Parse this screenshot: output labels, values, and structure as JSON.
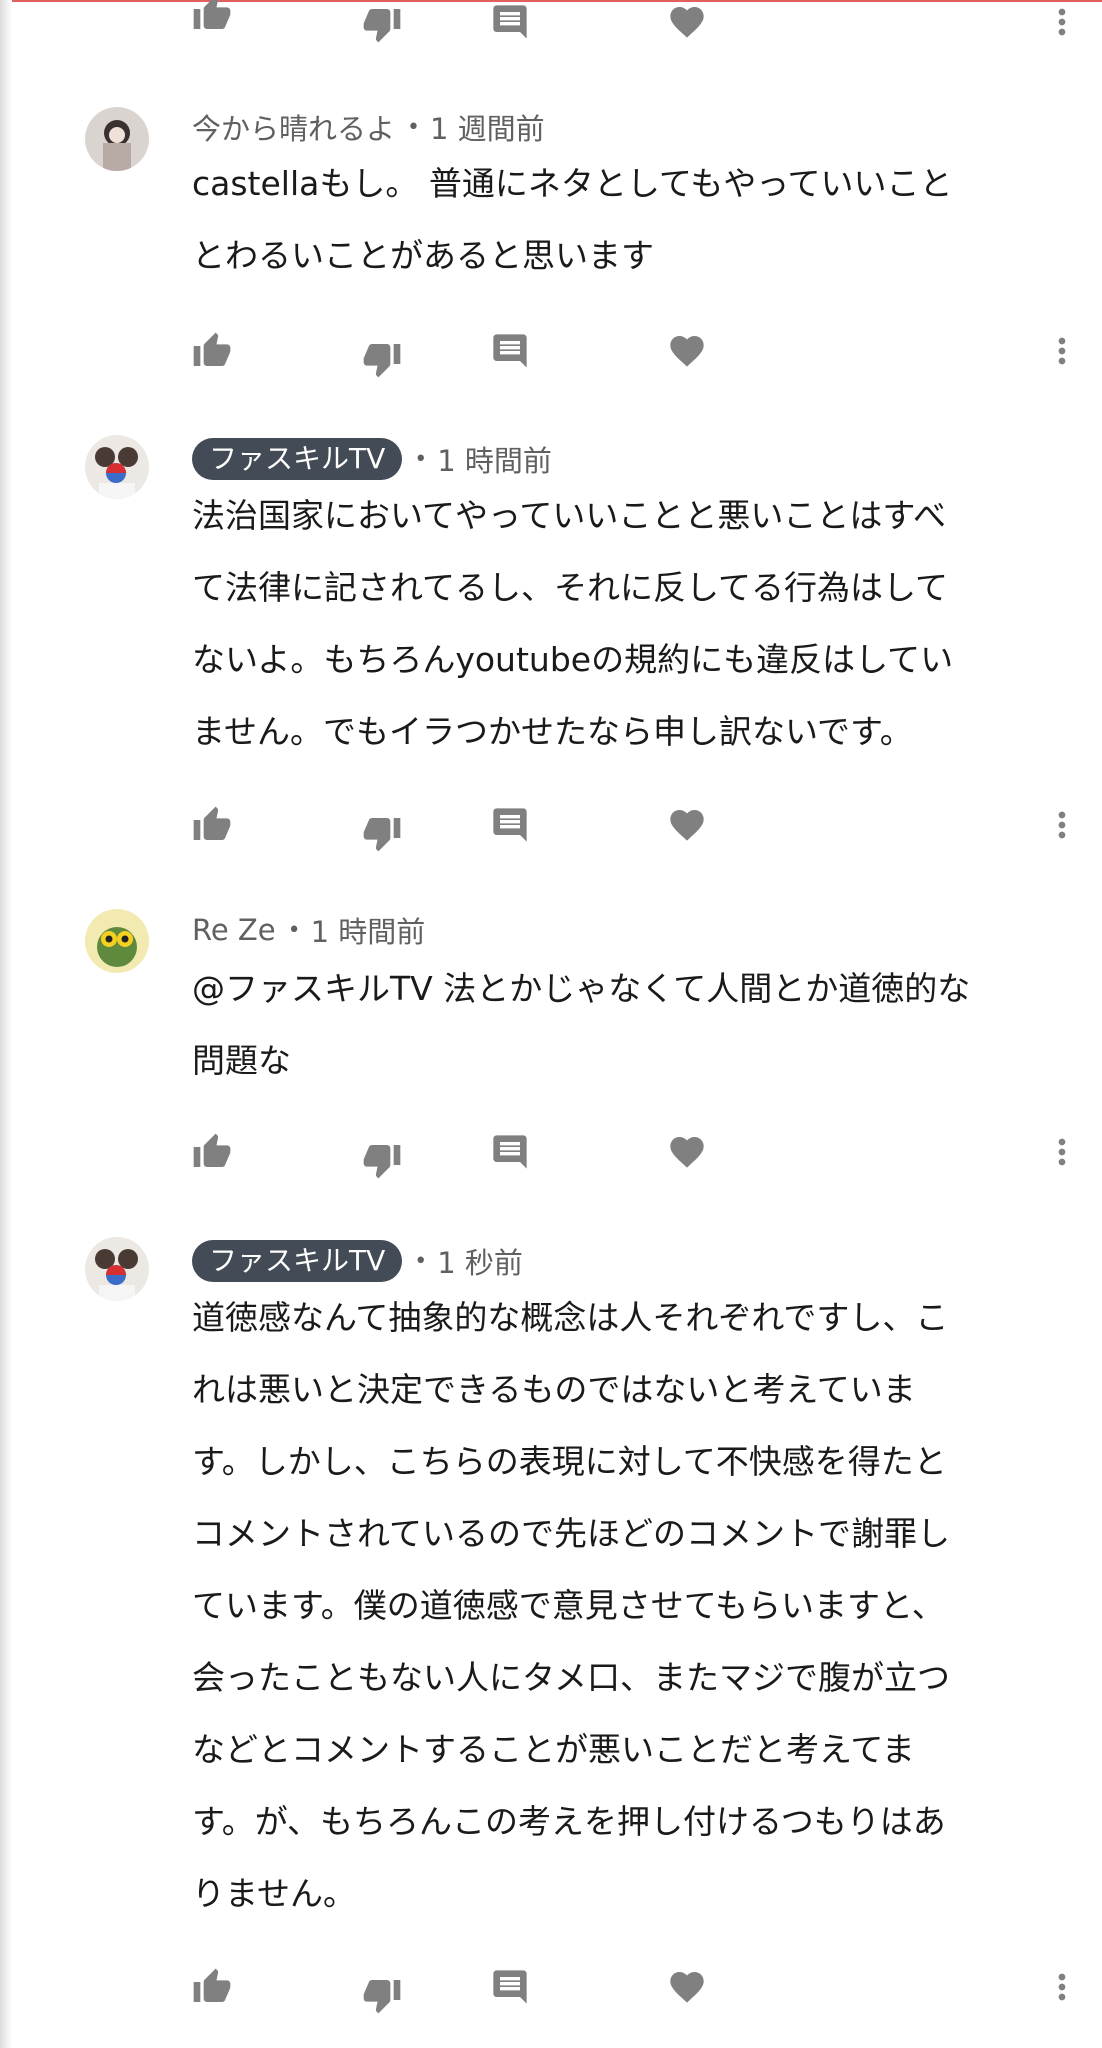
{
  "comments": [
    {
      "author": "",
      "author_badge": false,
      "time": "",
      "body": ""
    },
    {
      "author": "今から晴れるよ",
      "author_badge": false,
      "time": "1 週間前",
      "body": "castellaもし。 普通にネタとしてもやっていいこと\nとわるいことがあると思います"
    },
    {
      "author": "ファスキルTV",
      "author_badge": true,
      "time": "1 時間前",
      "body": "法治国家においてやっていいことと悪いことはすべ\nて法律に記されてるし、それに反してる行為はして\nないよ。もちろんyoutubeの規約にも違反はしてい\nません。でもイラつかせたなら申し訳ないです。"
    },
    {
      "author": "Re Ze",
      "author_badge": false,
      "time": "1 時間前",
      "body": "@ファスキルTV 法とかじゃなくて人間とか道徳的な\n問題な"
    },
    {
      "author": "ファスキルTV",
      "author_badge": true,
      "time": "1 秒前",
      "body": "道徳感なんて抽象的な概念は人それぞれですし、こ\nれは悪いと決定できるものではないと考えていま\nす。しかし、こちらの表現に対して不快感を得たと\nコメントされているので先ほどのコメントで謝罪し\nています。僕の道徳感で意見させてもらいますと、\n会ったこともない人にタメ口、またマジで腹が立つ\nなどとコメントすることが悪いことだと考えてま\nす。が、もちろんこの考えを押し付けるつもりはあ\nりません。"
    }
  ],
  "separator": "•",
  "icons": {
    "like": "thumb-up-icon",
    "dislike": "thumb-down-icon",
    "reply": "reply-comment-icon",
    "heart": "heart-icon",
    "more": "more-vert-icon"
  },
  "colors": {
    "badge_bg": "#434b56",
    "icon": "#808080",
    "meta_text": "#606060",
    "body_text": "#1a1a1a"
  }
}
